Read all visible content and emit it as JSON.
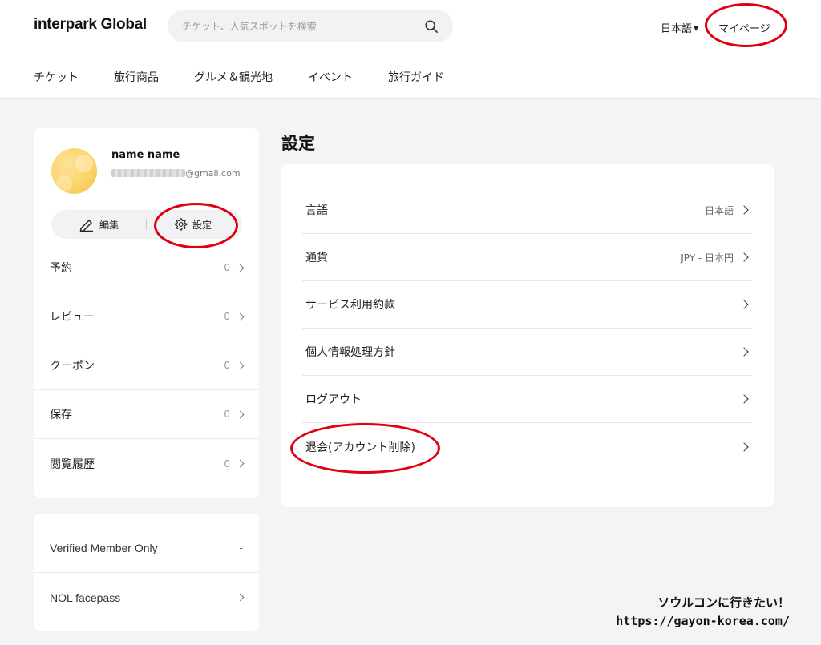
{
  "header": {
    "logo": "interpark Global",
    "search_placeholder": "チケット、人気スポットを検索",
    "language": "日本語",
    "mypage": "マイページ"
  },
  "nav": [
    "チケット",
    "旅行商品",
    "グルメ＆観光地",
    "イベント",
    "旅行ガイド"
  ],
  "profile": {
    "name": "name name",
    "email_visible": "@gmail.com",
    "edit_label": "編集",
    "settings_label": "設定"
  },
  "menu": [
    {
      "label": "予約",
      "count": "0"
    },
    {
      "label": "レビュー",
      "count": "0"
    },
    {
      "label": "クーポン",
      "count": "0"
    },
    {
      "label": "保存",
      "count": "0"
    },
    {
      "label": "閲覧履歴",
      "count": "0"
    }
  ],
  "member": [
    {
      "label": "Verified Member Only",
      "value": "-"
    },
    {
      "label": "NOL facepass",
      "value": ""
    }
  ],
  "settings": {
    "title": "設定",
    "rows": [
      {
        "label": "言語",
        "value": "日本語"
      },
      {
        "label": "通貨",
        "value": "JPY - 日本円"
      },
      {
        "label": "サービス利用約款",
        "value": ""
      },
      {
        "label": "個人情報処理方針",
        "value": ""
      },
      {
        "label": "ログアウト",
        "value": ""
      },
      {
        "label": "退会(アカウント削除)",
        "value": ""
      }
    ]
  },
  "watermark": {
    "line1": "ソウルコンに行きたい！",
    "line2": "https://gayon-korea.com/"
  },
  "colors": {
    "highlight_ring": "#e00010",
    "background": "#f4f4f4",
    "card": "#ffffff"
  }
}
